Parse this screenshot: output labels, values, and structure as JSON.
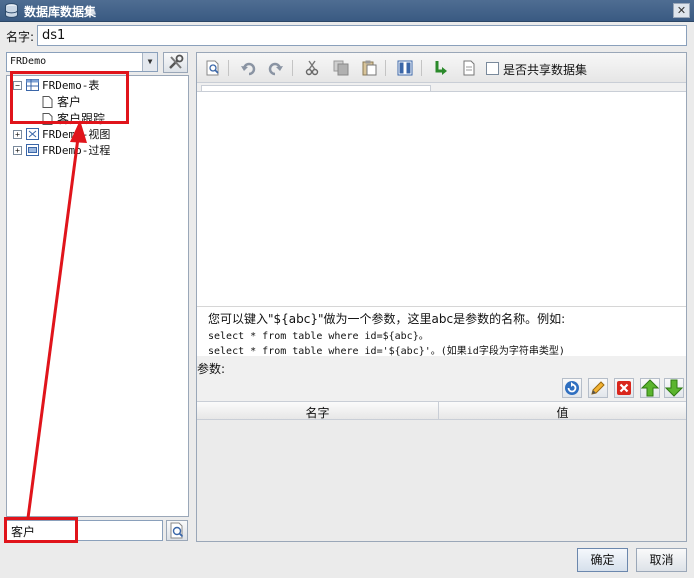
{
  "window": {
    "title": "数据库数据集",
    "close_label": "✕",
    "icons": [
      "database-icon"
    ]
  },
  "name_field": {
    "label": "名字:",
    "value": "ds1"
  },
  "left_panel": {
    "connection": "FRDemo",
    "tree": {
      "tables_node": "FRDemo-表",
      "tables_children": [
        "客户",
        "客户跟踪"
      ],
      "views_node": "FRDemo-视图",
      "procs_node": "FRDemo-过程"
    },
    "search_value": "客户"
  },
  "right_panel": {
    "toolbar_icons": [
      "preview-icon",
      "undo-icon",
      "redo-icon",
      "cut-icon",
      "copy-icon",
      "paste-icon",
      "columns-icon",
      "sql-icon",
      "page-icon"
    ],
    "share_label": "是否共享数据集",
    "share_checked": false,
    "hint": {
      "line1": "您可以键入\"${abc}\"做为一个参数，这里abc是参数的名称。例如:",
      "line2": "select * from table where id=${abc}。",
      "line3": "select * from table where id='${abc}'。(如果id字段为字符串类型)"
    },
    "params": {
      "label": "参数:",
      "buttons": [
        "refresh-icon",
        "edit-icon",
        "delete-icon",
        "move-up-icon",
        "move-down-icon"
      ],
      "columns": [
        "名字",
        "值"
      ]
    }
  },
  "footer": {
    "ok_label": "确定",
    "cancel_label": "取消"
  },
  "annotation_color": "#e0141b"
}
